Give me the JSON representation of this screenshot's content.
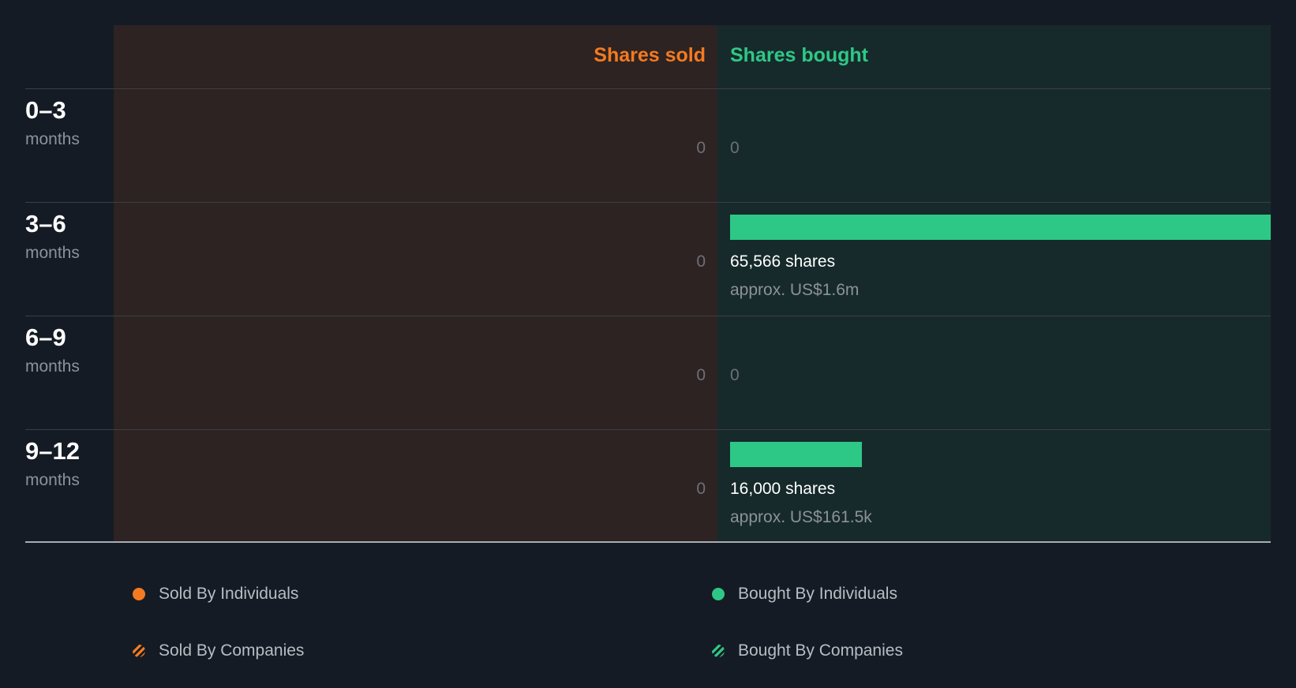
{
  "colors": {
    "sold": "#f47a20",
    "bought": "#2ec886"
  },
  "headers": {
    "sold": "Shares sold",
    "bought": "Shares bought"
  },
  "chart_data": {
    "type": "bar",
    "categories": [
      "0–3 months",
      "3–6 months",
      "6–9 months",
      "9–12 months"
    ],
    "periods": [
      {
        "range": "0–3",
        "unit": "months",
        "sold_label": "0",
        "bought_label": "0",
        "shares_text": "",
        "value_text": ""
      },
      {
        "range": "3–6",
        "unit": "months",
        "sold_label": "0",
        "bought_label": "",
        "shares_text": "65,566 shares",
        "value_text": "approx. US$1.6m"
      },
      {
        "range": "6–9",
        "unit": "months",
        "sold_label": "0",
        "bought_label": "0",
        "shares_text": "",
        "value_text": ""
      },
      {
        "range": "9–12",
        "unit": "months",
        "sold_label": "0",
        "bought_label": "",
        "shares_text": "16,000 shares",
        "value_text": "approx. US$161.5k"
      }
    ],
    "series": [
      {
        "name": "Shares sold",
        "values": [
          0,
          0,
          0,
          0
        ]
      },
      {
        "name": "Shares bought",
        "values": [
          0,
          65566,
          0,
          16000
        ]
      }
    ]
  },
  "legend": {
    "sold_individuals": "Sold By Individuals",
    "sold_companies": "Sold By Companies",
    "bought_individuals": "Bought By Individuals",
    "bought_companies": "Bought By Companies"
  }
}
